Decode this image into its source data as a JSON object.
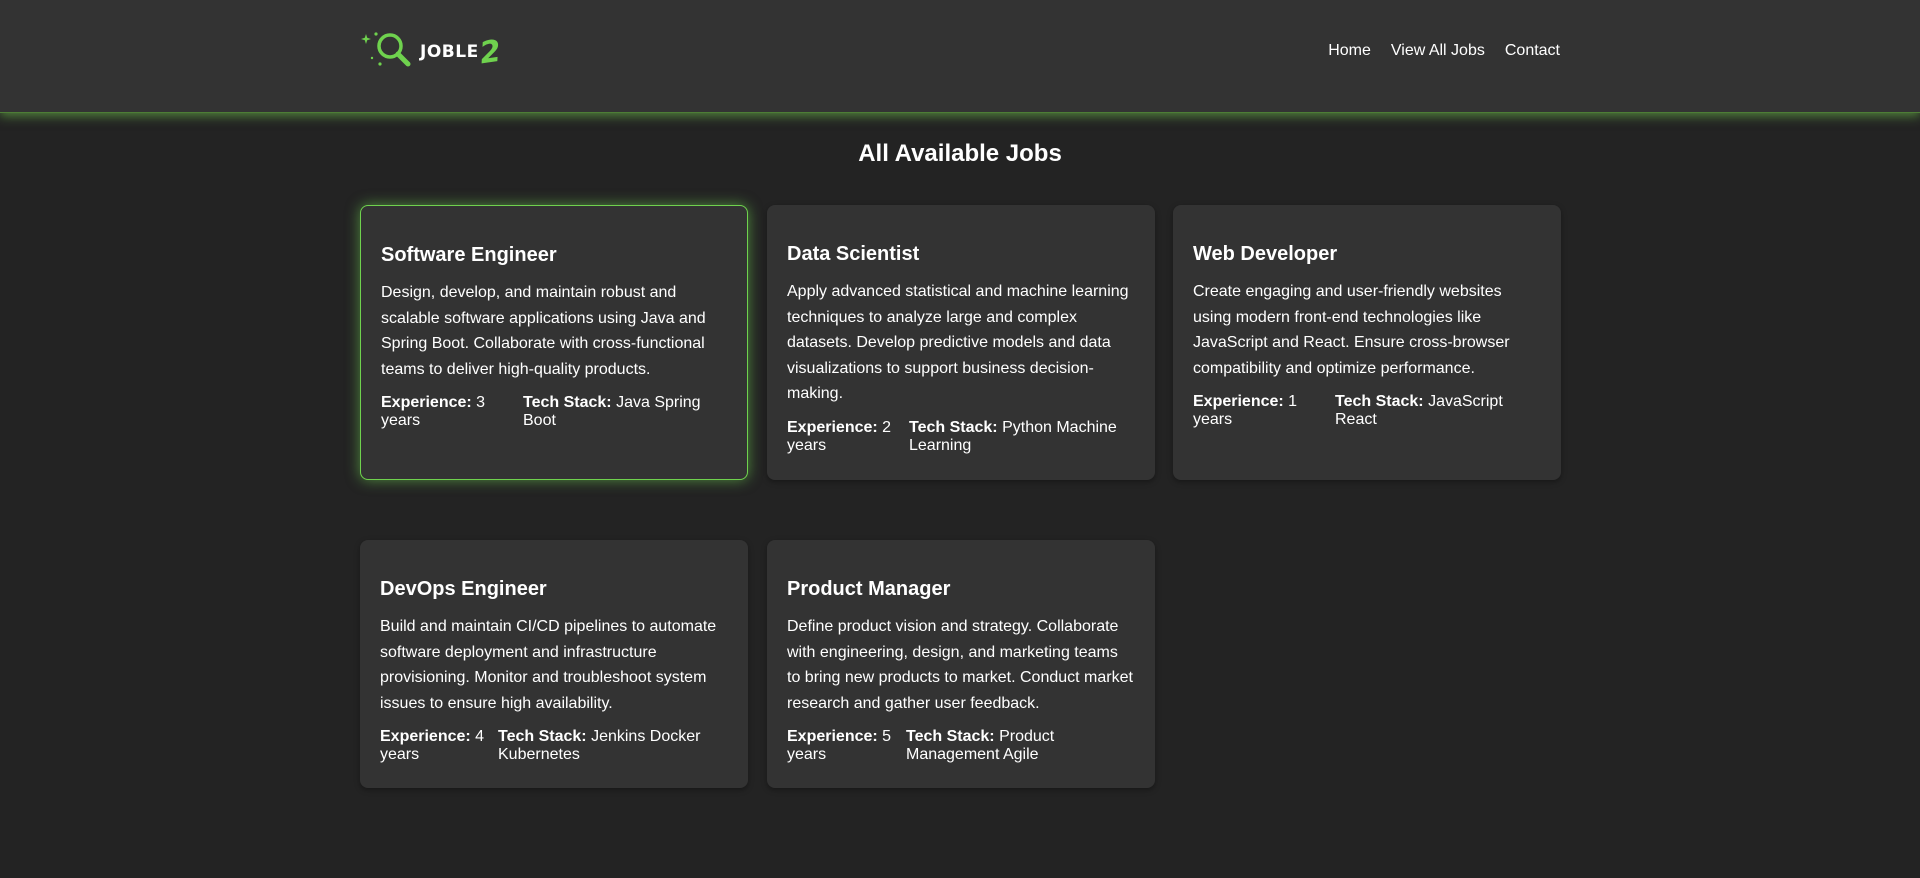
{
  "header": {
    "logo_main": "JOBLE",
    "logo_accent": "2",
    "nav": [
      {
        "label": "Home"
      },
      {
        "label": "View All Jobs"
      },
      {
        "label": "Contact"
      }
    ]
  },
  "page": {
    "title": "All Available Jobs"
  },
  "labels": {
    "experience": "Experience:",
    "tech_stack": "Tech Stack:"
  },
  "jobs": [
    {
      "title": "Software Engineer",
      "description": "Design, develop, and maintain robust and scalable software applications using Java and Spring Boot. Collaborate with cross-functional teams to deliver high-quality products.",
      "experience": "3 years",
      "tech_stack": "Java Spring Boot"
    },
    {
      "title": "Data Scientist",
      "description": "Apply advanced statistical and machine learning techniques to analyze large and complex datasets. Develop predictive models and data visualizations to support business decision-making.",
      "experience": "2 years",
      "tech_stack": "Python Machine Learning"
    },
    {
      "title": "Web Developer",
      "description": "Create engaging and user-friendly websites using modern front-end technologies like JavaScript and React. Ensure cross-browser compatibility and optimize performance.",
      "experience": "1 years",
      "tech_stack": "JavaScript React"
    },
    {
      "title": "DevOps Engineer",
      "description": "Build and maintain CI/CD pipelines to automate software deployment and infrastructure provisioning. Monitor and troubleshoot system issues to ensure high availability.",
      "experience": "4 years",
      "tech_stack": "Jenkins Docker Kubernetes"
    },
    {
      "title": "Product Manager",
      "description": "Define product vision and strategy. Collaborate with engineering, design, and marketing teams to bring new products to market. Conduct market research and gather user feedback.",
      "experience": "5 years",
      "tech_stack": "Product Management Agile"
    }
  ],
  "colors": {
    "background": "#232323",
    "card": "#333333",
    "accent": "#6fd24e"
  },
  "icons": {
    "logo": "magnifier-sparkle-icon"
  }
}
